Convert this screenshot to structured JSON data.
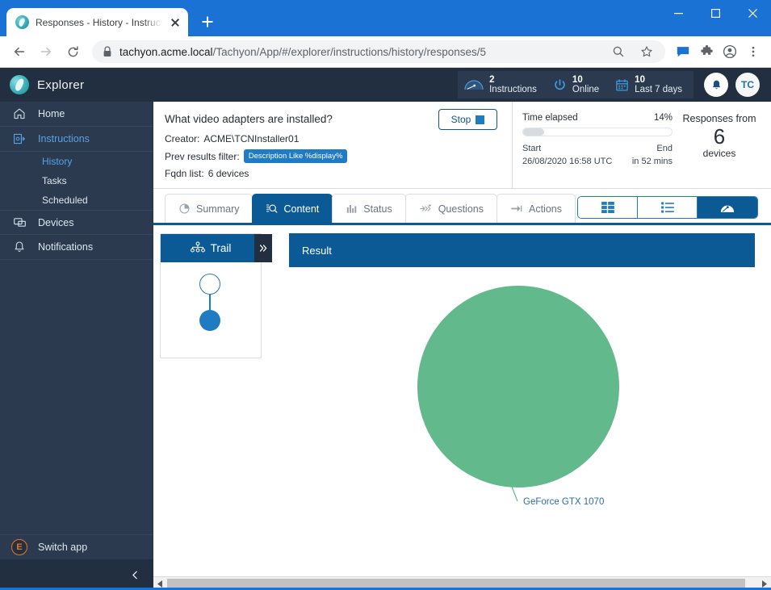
{
  "browser": {
    "tab_title": "Responses - History - Instructions",
    "url_secure": "tachyon.acme.local",
    "url_path": "/Tachyon/App/#/explorer/instructions/history/responses/5",
    "new_tab_label": "+",
    "back_icon": "back-arrow-icon",
    "forward_icon": "forward-arrow-icon",
    "reload_icon": "reload-icon",
    "zoom_icon": "search-icon",
    "bookmark_icon": "star-icon",
    "cast_icon": "comment-icon",
    "extensions_icon": "puzzle-icon",
    "profile_icon": "account-icon",
    "menu_icon": "kebab-menu-icon"
  },
  "app": {
    "brand": "Explorer",
    "sidebar": {
      "items": [
        {
          "label": "Home",
          "icon": "home-icon",
          "active": false
        },
        {
          "label": "Instructions",
          "icon": "instructions-icon",
          "active": true
        },
        {
          "label": "Devices",
          "icon": "devices-icon",
          "active": false
        },
        {
          "label": "Notifications",
          "icon": "bell-icon",
          "active": false
        }
      ],
      "sub_items": [
        {
          "label": "History",
          "active": true
        },
        {
          "label": "Tasks",
          "active": false
        },
        {
          "label": "Scheduled",
          "active": false
        }
      ],
      "switch_app": "Switch app",
      "switch_app_badge": "E",
      "collapse_icon": "chevron-left-icon"
    },
    "topbar": {
      "stats": [
        {
          "value": "2",
          "label": "Instructions",
          "icon": "gauge-icon"
        },
        {
          "value": "10",
          "label": "Online",
          "icon": "power-icon"
        },
        {
          "value": "10",
          "label": "Last 7 days",
          "icon": "calendar-icon"
        }
      ],
      "bell_icon": "bell-icon",
      "avatar_initials": "TC"
    },
    "question": {
      "title": "What video adapters are installed?",
      "creator_label": "Creator:",
      "creator_value": "ACME\\TCNInstaller01",
      "filter_label": "Prev results filter:",
      "filter_chip": "Description Like %display%",
      "fqdn_label": "Fqdn list:",
      "fqdn_value": "6 devices",
      "stop_button": "Stop"
    },
    "progress": {
      "elapsed_label": "Time elapsed",
      "elapsed_percent": "14%",
      "elapsed_value": 14,
      "start_label": "Start",
      "end_label": "End",
      "start_value": "26/08/2020 16:58 UTC",
      "end_value": "in 52 mins",
      "responses_label": "Responses from",
      "responses_count": "6",
      "responses_unit": "devices"
    },
    "tabs": [
      {
        "label": "Summary",
        "icon": "pie-chart-icon",
        "active": false
      },
      {
        "label": "Content",
        "icon": "content-search-icon",
        "active": true
      },
      {
        "label": "Status",
        "icon": "bar-chart-icon",
        "active": false
      },
      {
        "label": "Questions",
        "icon": "questions-icon",
        "active": false
      },
      {
        "label": "Actions",
        "icon": "actions-arrow-icon",
        "active": false
      }
    ],
    "view_modes": [
      {
        "icon": "table-view-icon",
        "active": false
      },
      {
        "icon": "list-view-icon",
        "active": false
      },
      {
        "icon": "chart-view-icon",
        "active": true
      }
    ],
    "trail": {
      "title": "Trail",
      "icon": "hierarchy-icon",
      "expand_icon": "double-chevron-right-icon",
      "nodes": [
        {
          "type": "outline"
        },
        {
          "type": "filled"
        }
      ]
    },
    "result": {
      "header": "Result"
    },
    "scrollbar": {
      "left_arrow": "scroll-left-icon",
      "right_arrow": "scroll-right-icon"
    }
  },
  "chart_data": {
    "type": "pie",
    "title": "Result",
    "categories": [
      "GeForce GTX 1070"
    ],
    "values": [
      100
    ],
    "colors": [
      "#62b98c"
    ],
    "labels": [
      "GeForce GTX 1070"
    ],
    "label_color": "#2b6ca3",
    "legend": "none",
    "total": 100,
    "units": "percent"
  }
}
